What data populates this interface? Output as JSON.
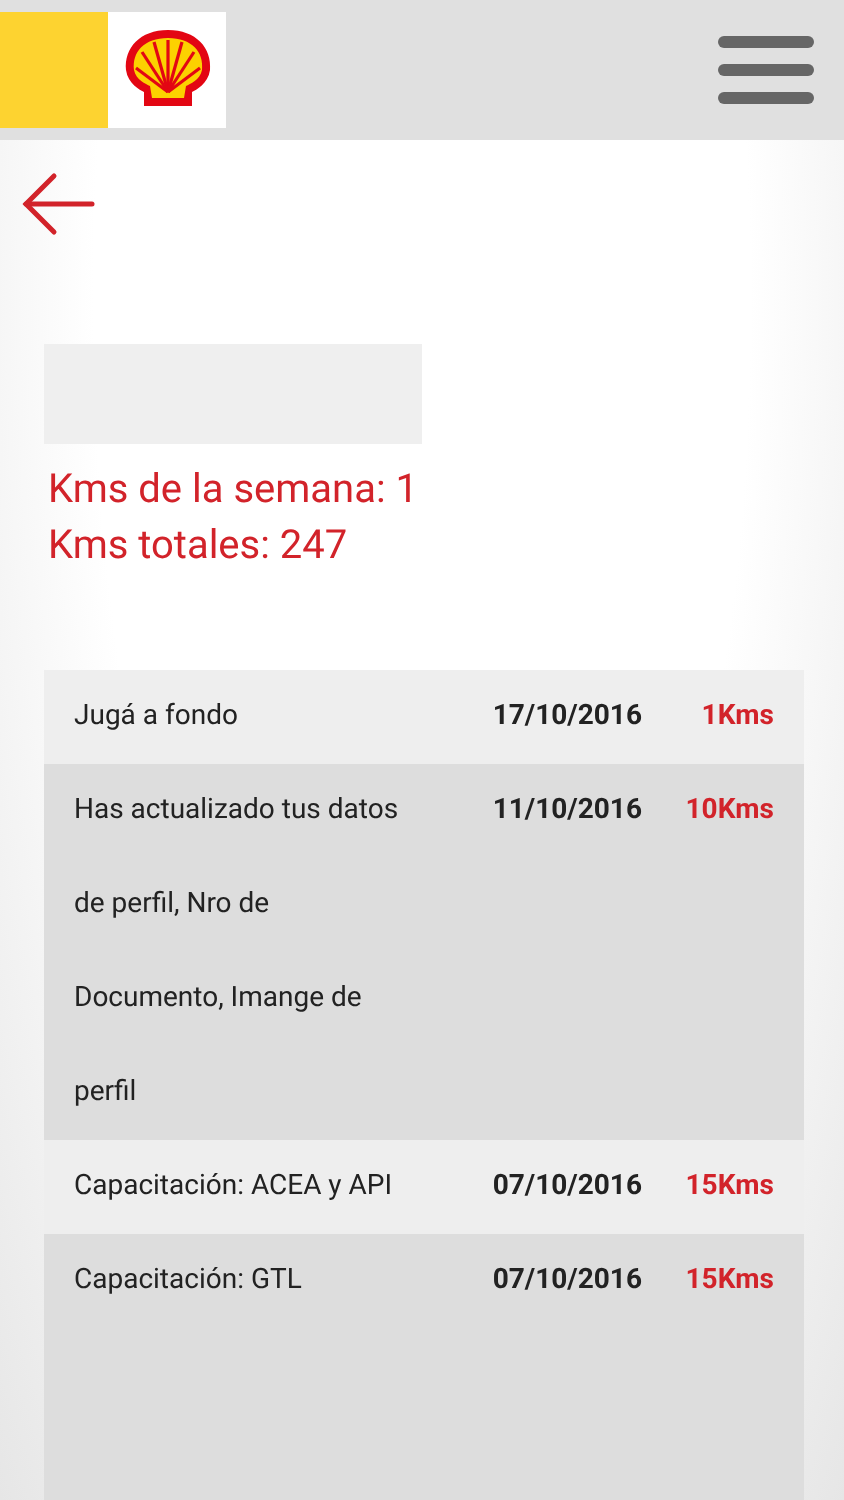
{
  "summary": {
    "week_kms": "Kms de la semana: 1",
    "total_kms": "Kms totales: 247"
  },
  "activities": [
    {
      "description": "Jugá a fondo",
      "date": "17/10/2016",
      "kms": "1Kms"
    },
    {
      "description": "Has actualizado tus datos de perfil, Nro de Documento, Imange de perfil",
      "date": "11/10/2016",
      "kms": "10Kms"
    },
    {
      "description": "Capacitación: ACEA y API",
      "date": "07/10/2016",
      "kms": "15Kms"
    },
    {
      "description": "Capacitación: GTL",
      "date": "07/10/2016",
      "kms": "15Kms"
    }
  ]
}
